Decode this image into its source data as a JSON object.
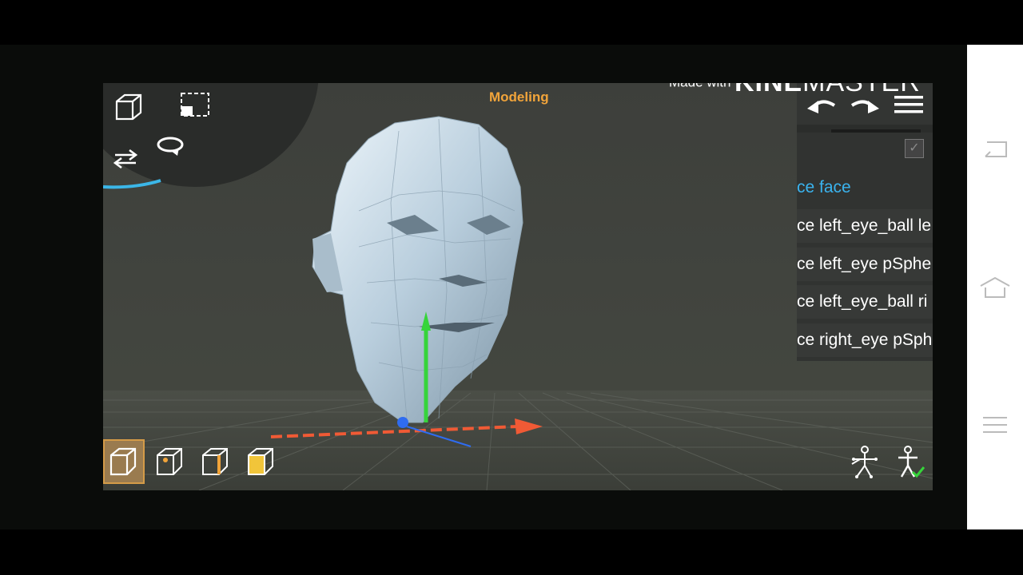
{
  "watermark": {
    "prefix": "Made with",
    "brand_bold": "KINE",
    "brand_light": "MASTER"
  },
  "mode_title": "Modeling",
  "toolbar": {
    "top_left": [
      "cube-view-icon",
      "select-region-icon",
      "swap-arrows-icon",
      "rotate-icon"
    ],
    "top_right": [
      "undo-icon",
      "redo-icon",
      "menu-icon"
    ],
    "bottom_right": [
      "skeleton-rig-icon",
      "character-check-icon"
    ]
  },
  "scene_list": {
    "items": [
      {
        "label": "ce face",
        "active": true
      },
      {
        "label": "ce left_eye_ball le",
        "active": false
      },
      {
        "label": "ce left_eye pSphe",
        "active": false
      },
      {
        "label": "ce left_eye_ball ri",
        "active": false
      },
      {
        "label": "ce right_eye pSph",
        "active": false
      }
    ]
  },
  "selection_modes": [
    {
      "name": "object-mode",
      "selected": true
    },
    {
      "name": "vertex-mode",
      "selected": false
    },
    {
      "name": "edge-mode",
      "selected": false
    },
    {
      "name": "face-mode",
      "selected": false
    }
  ],
  "colors": {
    "accent_orange": "#f1a43a",
    "accent_blue": "#3ab3ee",
    "axis_x": "#f05a35",
    "axis_y": "#36d43a",
    "axis_z": "#2f6cf0",
    "mesh": "#c9dbe8"
  },
  "android_nav": [
    "back-icon",
    "home-icon",
    "recents-icon"
  ]
}
